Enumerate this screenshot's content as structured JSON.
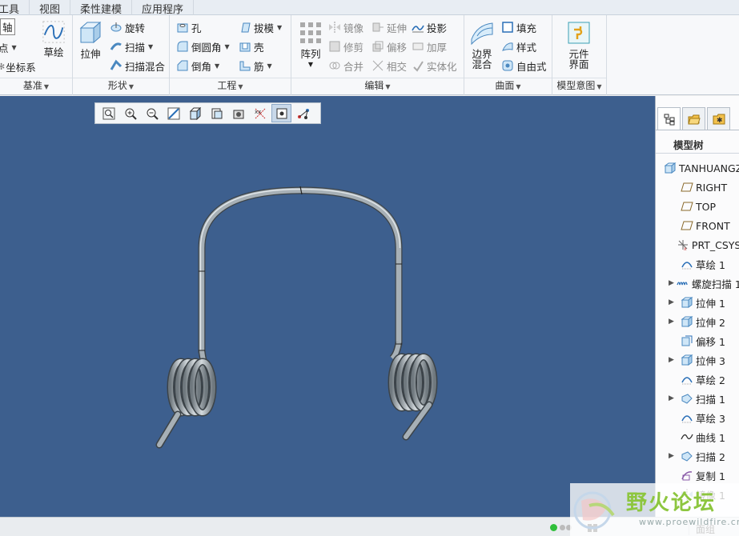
{
  "menu": [
    "工具",
    "视图",
    "柔性建模",
    "应用程序"
  ],
  "colors": {
    "viewport_bg": "#3d5f8e",
    "spring": "#9ea7ad",
    "watermark_green": "#8dc63f"
  },
  "groups": {
    "datum": {
      "label": "基准",
      "items": [
        "轴",
        "点",
        "坐标系",
        "草绘"
      ]
    },
    "shapes": {
      "label": "形状",
      "items": [
        "拉伸",
        "旋转",
        "扫描",
        "扫描混合"
      ]
    },
    "engineering": {
      "label": "工程",
      "items": [
        "孔",
        "倒圆角",
        "倒角",
        "拔模",
        "壳",
        "筋"
      ]
    },
    "editing": {
      "label": "编辑",
      "pattern": "阵列",
      "items": [
        "镜像",
        "修剪",
        "合并",
        "延伸",
        "偏移",
        "相交",
        "投影",
        "加厚",
        "实体化"
      ]
    },
    "surfaces": {
      "label": "曲面",
      "items": [
        "边界混合",
        "填充",
        "样式",
        "自由式"
      ]
    },
    "model_intent": {
      "label": "模型意图",
      "items": [
        "元件界面"
      ]
    }
  },
  "view_toolbar": [
    "refit-icon",
    "zoom-in-icon",
    "zoom-out-icon",
    "repaint-icon",
    "display-style-icon",
    "saved-views-icon",
    "view-manager-icon",
    "datum-display-icon",
    "spin-center-icon",
    "annotation-display-icon"
  ],
  "side": {
    "title": "模型树",
    "tabs": [
      "model-tree-tab-icon",
      "folder-browser-tab-icon",
      "favorites-tab-icon"
    ],
    "tree": [
      {
        "label": "TANHUANGZ",
        "icon": "part-icon",
        "exp": false,
        "root": true
      },
      {
        "label": "RIGHT",
        "icon": "datum-plane-icon",
        "exp": false
      },
      {
        "label": "TOP",
        "icon": "datum-plane-icon",
        "exp": false
      },
      {
        "label": "FRONT",
        "icon": "datum-plane-icon",
        "exp": false
      },
      {
        "label": "PRT_CSYS",
        "icon": "csys-icon",
        "exp": false
      },
      {
        "label": "草绘 1",
        "icon": "sketch-icon",
        "exp": false
      },
      {
        "label": "螺旋扫描 1",
        "icon": "helical-sweep-icon",
        "exp": true
      },
      {
        "label": "拉伸 1",
        "icon": "extrude-icon",
        "exp": true
      },
      {
        "label": "拉伸 2",
        "icon": "extrude-icon",
        "exp": true
      },
      {
        "label": "偏移 1",
        "icon": "offset-icon",
        "exp": false
      },
      {
        "label": "拉伸 3",
        "icon": "extrude-icon",
        "exp": true
      },
      {
        "label": "草绘 2",
        "icon": "sketch-icon",
        "exp": false
      },
      {
        "label": "扫描 1",
        "icon": "sweep-icon",
        "exp": true
      },
      {
        "label": "草绘 3",
        "icon": "sketch-icon",
        "exp": false
      },
      {
        "label": "曲线 1",
        "icon": "curve-icon",
        "exp": false
      },
      {
        "label": "扫描 2",
        "icon": "sweep-icon",
        "exp": true
      },
      {
        "label": "复制 1",
        "icon": "copy-icon",
        "exp": false
      },
      {
        "label": "镜像 1",
        "icon": "mirror-icon",
        "exp": false
      }
    ]
  },
  "status": {
    "filter": "面组"
  },
  "watermark": {
    "text": "野火论坛",
    "url": "www.proewildfire.cn"
  }
}
